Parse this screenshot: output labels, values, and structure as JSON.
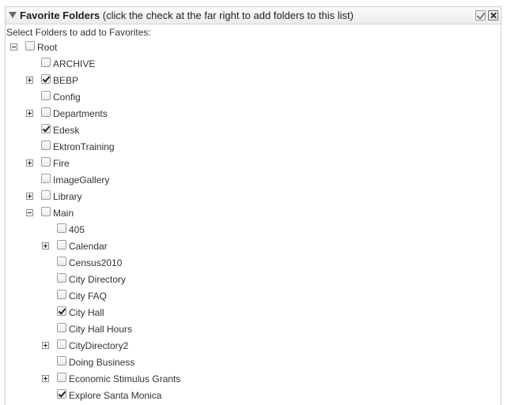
{
  "header": {
    "title": "Favorite Folders",
    "subtitle": " (click the check at the far right to add folders to this list)"
  },
  "instructions": "Select Folders to add to Favorites:",
  "tree": {
    "root": {
      "label": "Root",
      "checked": false,
      "toggle": "minus"
    },
    "level1": [
      {
        "label": "ARCHIVE",
        "checked": false,
        "toggle": "none"
      },
      {
        "label": "BEBP",
        "checked": true,
        "toggle": "plus"
      },
      {
        "label": "Config",
        "checked": false,
        "toggle": "none"
      },
      {
        "label": "Departments",
        "checked": false,
        "toggle": "plus"
      },
      {
        "label": "Edesk",
        "checked": true,
        "toggle": "none"
      },
      {
        "label": "EktronTraining",
        "checked": false,
        "toggle": "none"
      },
      {
        "label": "Fire",
        "checked": false,
        "toggle": "plus"
      },
      {
        "label": "ImageGallery",
        "checked": false,
        "toggle": "none"
      },
      {
        "label": "Library",
        "checked": false,
        "toggle": "plus"
      },
      {
        "label": "Main",
        "checked": false,
        "toggle": "minus"
      }
    ],
    "main_children": [
      {
        "label": "405",
        "checked": false,
        "toggle": "none"
      },
      {
        "label": "Calendar",
        "checked": false,
        "toggle": "plus"
      },
      {
        "label": "Census2010",
        "checked": false,
        "toggle": "none"
      },
      {
        "label": "City Directory",
        "checked": false,
        "toggle": "none"
      },
      {
        "label": "City FAQ",
        "checked": false,
        "toggle": "none"
      },
      {
        "label": "City Hall",
        "checked": true,
        "toggle": "none"
      },
      {
        "label": "City Hall Hours",
        "checked": false,
        "toggle": "none"
      },
      {
        "label": "CityDirectory2",
        "checked": false,
        "toggle": "plus"
      },
      {
        "label": "Doing Business",
        "checked": false,
        "toggle": "none"
      },
      {
        "label": "Economic Stimulus Grants",
        "checked": false,
        "toggle": "plus"
      },
      {
        "label": "Explore Santa Monica",
        "checked": true,
        "toggle": "none"
      }
    ]
  },
  "icons": {
    "collapse": "triangle-down-icon",
    "add_favorite": "check-icon",
    "close": "close-icon"
  }
}
